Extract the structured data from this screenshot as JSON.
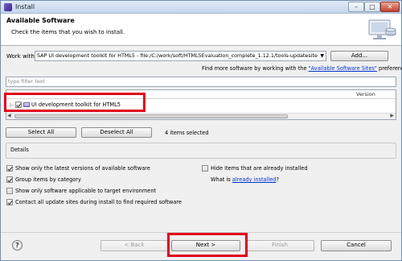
{
  "window": {
    "title": "Install",
    "minimize_glyph": "–",
    "maximize_glyph": "□",
    "close_glyph": "✕"
  },
  "banner": {
    "title": "Available Software",
    "subtitle": "Check the items that you wish to install.",
    "icon": "install-wizard-icon"
  },
  "work_with": {
    "label": "Work with:",
    "value": "SAP UI development toolkit for HTML5 - file:/C:/work/soft/HTML5Evaluation_complete_1.12.1/tools-updatesite",
    "add_button": "Add...",
    "hint_prefix": "Find more software by working with the ",
    "hint_link": "\"Available Software Sites\"",
    "hint_suffix": " preferences."
  },
  "filter": {
    "placeholder": "type filter text"
  },
  "tree": {
    "columns": {
      "name": "",
      "version": "Version"
    },
    "items": [
      {
        "label": "UI development toolkit for HTML5",
        "checked": true,
        "expander": "▷",
        "icon": "feature-group-icon"
      }
    ]
  },
  "selection": {
    "select_all": "Select All",
    "deselect_all": "Deselect All",
    "count": "4 items selected"
  },
  "details": {
    "label": "Details"
  },
  "options": {
    "show_latest": {
      "label": "Show only the latest versions of available software",
      "checked": true
    },
    "group_by_category": {
      "label": "Group items by category",
      "checked": true
    },
    "show_target_env": {
      "label": "Show only software applicable to target environment",
      "checked": false
    },
    "contact_all_sites": {
      "label": "Contact all update sites during install to find required software",
      "checked": true
    },
    "hide_installed": {
      "label": "Hide items that are already installed",
      "checked": false
    },
    "what_installed_prefix": "What is ",
    "what_installed_link": "already installed",
    "what_installed_suffix": "?"
  },
  "footer": {
    "help": "?",
    "back": "< Back",
    "next": "Next >",
    "finish": "Finish",
    "cancel": "Cancel"
  },
  "colors": {
    "highlight": "#e0001a",
    "link": "#0033cc"
  }
}
